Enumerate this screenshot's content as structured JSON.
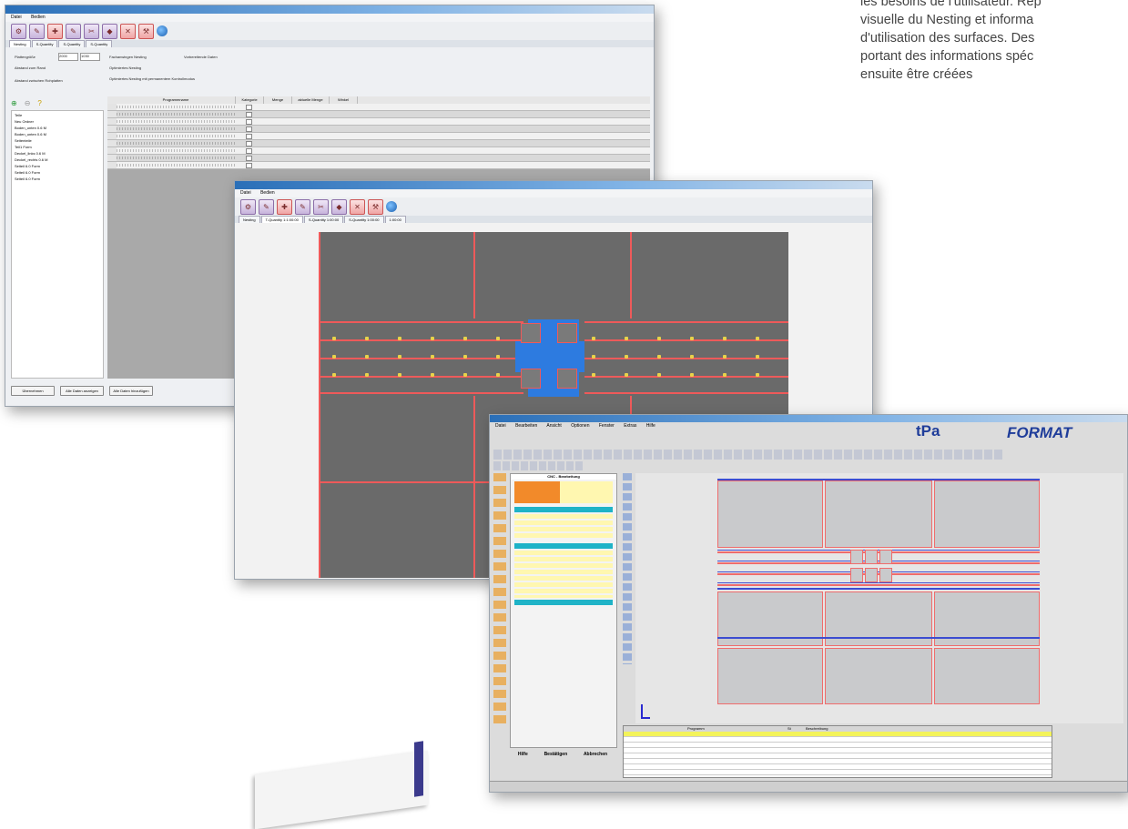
{
  "description": {
    "lines": [
      "les besoins de l'utilisateur. Rep",
      "visuelle du Nesting et informa",
      "d'utilisation des surfaces. Des",
      "portant des informations spéc",
      "ensuite être créées"
    ]
  },
  "window1": {
    "menu": [
      "Datei",
      "Bedien"
    ],
    "field_labels": [
      "Plattengröße",
      "Abstand zum Rand",
      "Abstand zwischen Rohplatten"
    ],
    "plate_size": [
      "2000",
      "1030"
    ],
    "options": [
      "Fachanwingen Nesting",
      "Optimiertes Nesting",
      "Optimiertes Nesting mit permanentem Kontrollmodus"
    ],
    "radio_option": "Vorbereitende Daten",
    "table_headers": [
      "Programmname",
      "Kategorie",
      "Menge",
      "aktuelle Menge",
      "Winkel"
    ],
    "row_count": 9,
    "tree_items": [
      "Teile",
      "Neu Ordner",
      "Boden_unten 0.6 M",
      "Boden_unten 0.6 M",
      "Seitenteile",
      "Teil1 Form",
      "Deckel_links 0.6 M",
      "Deckel_rechts 0.6 M",
      "Seiteil 6.0 Form",
      "Seiteil 6.0 Form",
      "Seiteil 6.0 Form"
    ],
    "buttons": [
      "Übernehmen",
      "Alle Daten anzeigen",
      "Alle Daten hinzufügen"
    ]
  },
  "window2": {
    "menu": [
      "Datei",
      "Bedien"
    ],
    "tabs": [
      "Nesting",
      "T-Quantity 1:1:00:00",
      "S-Quantity 1:00:00",
      "S-Quantity 1:00:00",
      "1:00:00"
    ]
  },
  "window3": {
    "menu": [
      "Datei",
      "Bearbeiten",
      "Ansicht",
      "Optionen",
      "Fenster",
      "Extras",
      "Hilfe"
    ],
    "logo_tpa": "tPa",
    "logo_format": "FORMAT",
    "panel_header": "CNC - Bearbeitung",
    "footer_buttons": [
      "Hilfe",
      "Bestätigen",
      "Abbrechen"
    ],
    "table_headers": [
      "Programm",
      "St",
      "Beschreibung"
    ],
    "row_count": 8
  },
  "colors": {
    "sheet": "#6a6a6a",
    "cut_line": "#ee5a5a",
    "accent_blue": "#2d7be0",
    "panel_cyan": "#1fb3c7",
    "panel_orange": "#f28a2a",
    "panel_yellow": "#fff7b0"
  }
}
